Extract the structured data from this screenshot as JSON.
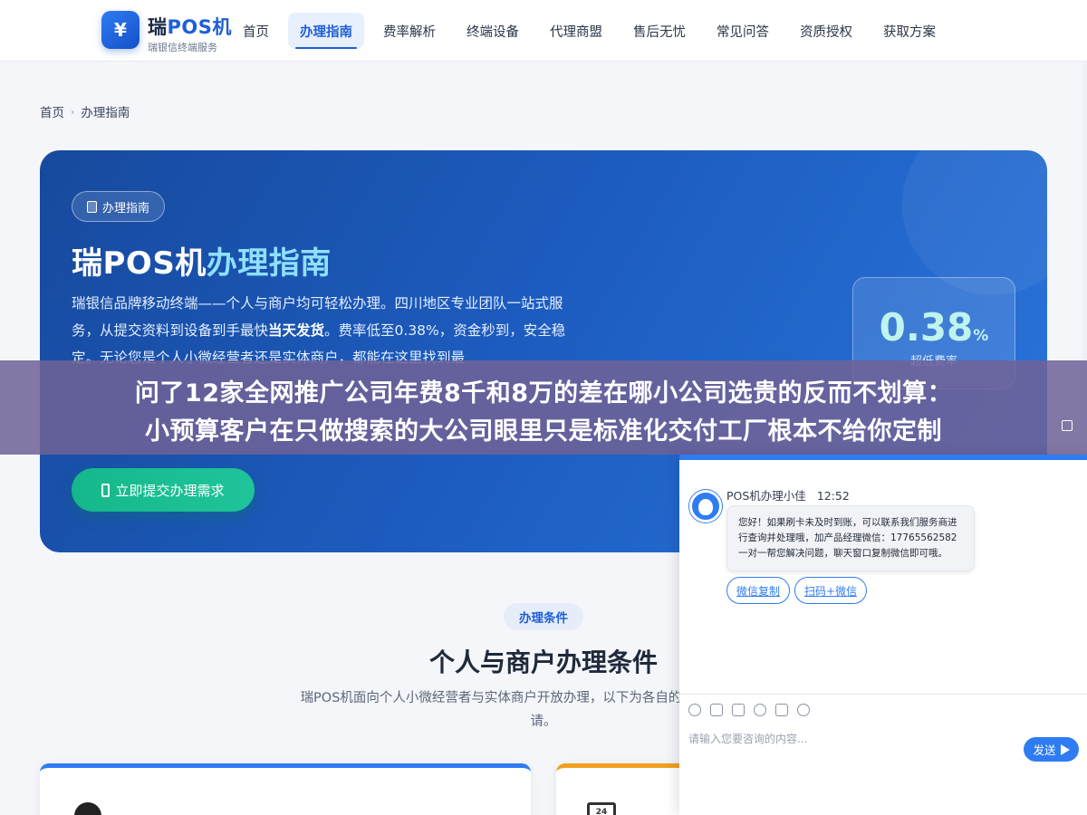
{
  "header": {
    "logo_icon": "¥",
    "logo_title_prefix": "瑞",
    "logo_title_brand": "POS机",
    "logo_subtitle": "瑞银信终端服务",
    "nav": [
      {
        "label": "首页",
        "active": false
      },
      {
        "label": "办理指南",
        "active": true
      },
      {
        "label": "费率解析",
        "active": false
      },
      {
        "label": "终端设备",
        "active": false
      },
      {
        "label": "代理商盟",
        "active": false
      },
      {
        "label": "售后无忧",
        "active": false
      },
      {
        "label": "常见问答",
        "active": false
      },
      {
        "label": "资质授权",
        "active": false
      },
      {
        "label": "获取方案",
        "active": false
      }
    ]
  },
  "breadcrumb": {
    "home": "首页",
    "separator": "›",
    "current": "办理指南"
  },
  "hero": {
    "badge": "办理指南",
    "title_main": "瑞POS机",
    "title_highlight": "办理指南",
    "desc_part1": "瑞银信品牌移动终端——个人与商户均可轻松办理。四川地区专业团队一站式服务，从提交资料到设备到手最快",
    "desc_bold": "当天发货",
    "desc_part2": "。费率低至0.38%，资金秒到，安全稳定。无论您是个人小微经营者还是实体商户，都能在这里找到最",
    "cta": "立即提交办理需求",
    "rate_value": "0.38",
    "rate_unit": "%",
    "rate_label": "超低费率"
  },
  "conditions": {
    "chip": "办理条件",
    "title": "个人与商户办理条件",
    "desc": "瑞POS机面向个人小微经营者与实体商户开放办理，以下为各自的条件，即可快速申请。",
    "card2_icon_text": "24"
  },
  "banner": {
    "line1": "问了12家全网推广公司年费8千和8万的差在哪小公司选贵的反而不划算：",
    "line2": "小预算客户在只做搜索的大公司眼里只是标准化交付工厂根本不给你定制"
  },
  "chat": {
    "agent_name": "POS机办理小佳",
    "time": "12:52",
    "message": "您好！如果刷卡未及时到账，可以联系我们服务商进行查询并处理哦，加产品经理微信：17765562582 一对一帮您解决问题，聊天窗口复制微信即可哦。",
    "btn_copy": "微信复制",
    "btn_scan": "扫码+微信",
    "input_placeholder": "请输入您要咨询的内容...",
    "send": "发送"
  },
  "colors": {
    "brand_blue": "#1e5fd6",
    "cta_green": "#14b88a",
    "banner_purple": "#706296"
  }
}
